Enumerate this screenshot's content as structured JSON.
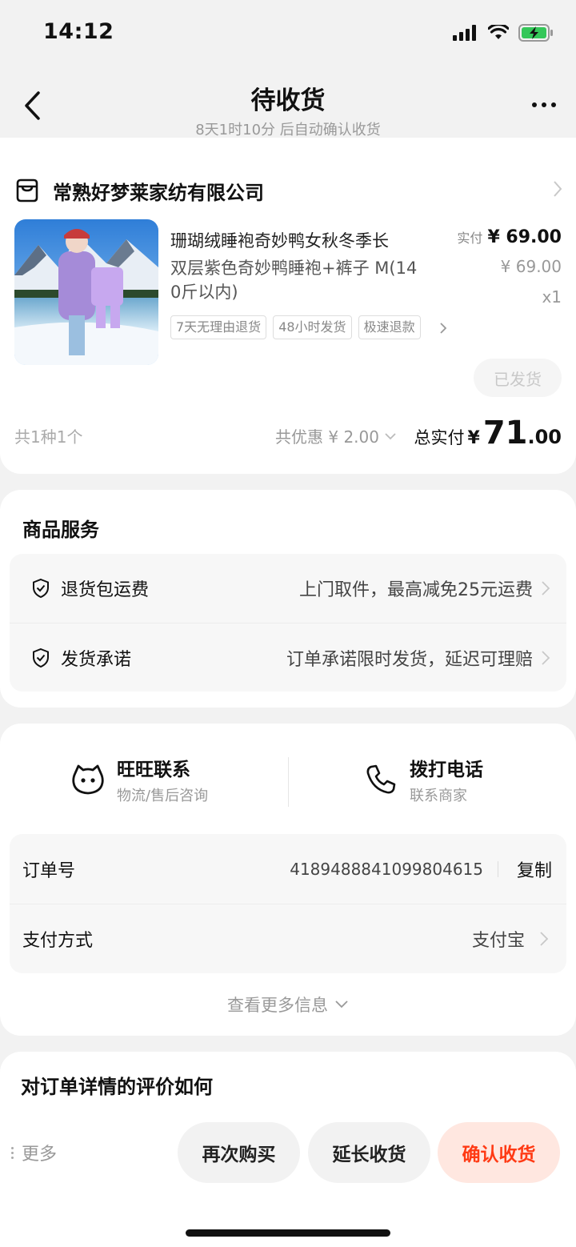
{
  "status_bar": {
    "time": "14:12"
  },
  "nav": {
    "title": "待收货",
    "subtitle": "8天1时10分 后自动确认收货"
  },
  "order": {
    "shop_name": "常熟好梦莱家纺有限公司",
    "product": {
      "title": "珊瑚绒睡袍奇妙鸭女秋冬季长",
      "sku_line1": "双层紫色奇妙鸭睡袍+裤子 M(14",
      "sku_line2": "0斤以内)",
      "tags": [
        "7天无理由退货",
        "48小时发货",
        "极速退款"
      ],
      "price_label": "实付",
      "price": "¥ 69.00",
      "original_price": "¥ 69.00",
      "quantity": "x1",
      "status_button": "已发货"
    },
    "summary": {
      "count": "共1种1个",
      "discount": "共优惠 ¥ 2.00",
      "total_label": "总实付",
      "total_currency": "¥",
      "total_integer": "71",
      "total_decimal": ".00"
    }
  },
  "services": {
    "title": "商品服务",
    "items": [
      {
        "name": "退货包运费",
        "desc": "上门取件，最高减免25元运费"
      },
      {
        "name": "发货承诺",
        "desc": "订单承诺限时发货，延迟可理赔"
      }
    ]
  },
  "contact": {
    "wangwang_title": "旺旺联系",
    "wangwang_sub": "物流/售后咨询",
    "phone_title": "拨打电话",
    "phone_sub": "联系商家"
  },
  "info": {
    "order_no_label": "订单号",
    "order_no": "4189488841099804615",
    "copy_label": "复制",
    "payment_label": "支付方式",
    "payment_value": "支付宝",
    "more_info": "查看更多信息"
  },
  "rating": {
    "title": "对订单详情的评价如何"
  },
  "actions": {
    "more": "更多",
    "rebuy": "再次购买",
    "extend": "延长收货",
    "confirm": "确认收货"
  },
  "colors": {
    "accent": "#ff3a14",
    "accent_bg": "#ffe7e0",
    "battery": "#34c759"
  },
  "icons": [
    "back-arrow-icon",
    "more-dots-icon",
    "store-icon",
    "chevron-right-icon",
    "shield-check-icon",
    "wangwang-icon",
    "phone-icon",
    "chevron-down-icon"
  ]
}
